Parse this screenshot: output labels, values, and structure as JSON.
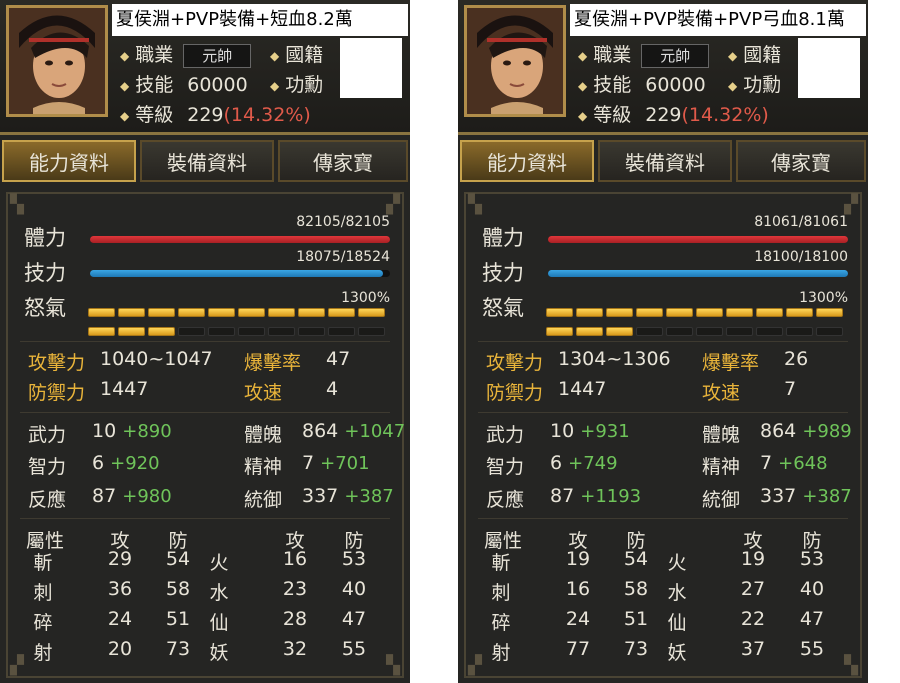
{
  "panels": [
    {
      "name": "夏侯淵+PVP裝備+短血8.2萬",
      "job_label": "職業",
      "job_value": "元帥",
      "nation_label": "國籍",
      "skill_label": "技能",
      "skill_value": "60000",
      "merit_label": "功勳",
      "level_label": "等級",
      "level_value": "229",
      "level_pct": "(14.32%)",
      "tabs": [
        "能力資料",
        "裝備資料",
        "傳家寶"
      ],
      "hp_label": "體力",
      "hp_text": "82105/82105",
      "hp_frac": 1.0,
      "sp_label": "技力",
      "sp_text": "18075/18524",
      "sp_frac": 0.976,
      "rage_label": "怒氣",
      "rage_text": "1300%",
      "rage_on": 13,
      "rage_total": 20,
      "atk_label": "攻擊力",
      "atk_value": "1040~1047",
      "crit_label": "爆擊率",
      "crit_value": "47",
      "def_label": "防禦力",
      "def_value": "1447",
      "spd_label": "攻速",
      "spd_value": "4",
      "wu_label": "武力",
      "wu_base": "10",
      "wu_bonus": "+890",
      "tp_label": "體魄",
      "tp_base": "864",
      "tp_bonus": "+1047",
      "zl_label": "智力",
      "zl_base": "6",
      "zl_bonus": "+920",
      "js_label": "精神",
      "js_base": "7",
      "js_bonus": "+701",
      "fy_label": "反應",
      "fy_base": "87",
      "fy_bonus": "+980",
      "ty_label": "統御",
      "ty_base": "337",
      "ty_bonus": "+387",
      "attr_header": [
        "屬性",
        "攻",
        "防",
        "攻",
        "防"
      ],
      "attr_rows": [
        [
          "斬",
          "29",
          "54",
          "火",
          "16",
          "53"
        ],
        [
          "刺",
          "36",
          "58",
          "水",
          "23",
          "40"
        ],
        [
          "碎",
          "24",
          "51",
          "仙",
          "28",
          "47"
        ],
        [
          "射",
          "20",
          "73",
          "妖",
          "32",
          "55"
        ]
      ]
    },
    {
      "name": "夏侯淵+PVP裝備+PVP弓血8.1萬",
      "job_label": "職業",
      "job_value": "元帥",
      "nation_label": "國籍",
      "skill_label": "技能",
      "skill_value": "60000",
      "merit_label": "功勳",
      "level_label": "等級",
      "level_value": "229",
      "level_pct": "(14.32%)",
      "tabs": [
        "能力資料",
        "裝備資料",
        "傳家寶"
      ],
      "hp_label": "體力",
      "hp_text": "81061/81061",
      "hp_frac": 1.0,
      "sp_label": "技力",
      "sp_text": "18100/18100",
      "sp_frac": 1.0,
      "rage_label": "怒氣",
      "rage_text": "1300%",
      "rage_on": 13,
      "rage_total": 20,
      "atk_label": "攻擊力",
      "atk_value": "1304~1306",
      "crit_label": "爆擊率",
      "crit_value": "26",
      "def_label": "防禦力",
      "def_value": "1447",
      "spd_label": "攻速",
      "spd_value": "7",
      "wu_label": "武力",
      "wu_base": "10",
      "wu_bonus": "+931",
      "tp_label": "體魄",
      "tp_base": "864",
      "tp_bonus": "+989",
      "zl_label": "智力",
      "zl_base": "6",
      "zl_bonus": "+749",
      "js_label": "精神",
      "js_base": "7",
      "js_bonus": "+648",
      "fy_label": "反應",
      "fy_base": "87",
      "fy_bonus": "+1193",
      "ty_label": "統御",
      "ty_base": "337",
      "ty_bonus": "+387",
      "attr_header": [
        "屬性",
        "攻",
        "防",
        "攻",
        "防"
      ],
      "attr_rows": [
        [
          "斬",
          "19",
          "54",
          "火",
          "19",
          "53"
        ],
        [
          "刺",
          "16",
          "58",
          "水",
          "27",
          "40"
        ],
        [
          "碎",
          "24",
          "51",
          "仙",
          "22",
          "47"
        ],
        [
          "射",
          "77",
          "73",
          "妖",
          "37",
          "55"
        ]
      ]
    }
  ],
  "colors": {
    "hp": "#e0363a",
    "sp": "#3aa6e6",
    "gold": "#e9b43a",
    "bonus": "#6fc45a"
  }
}
